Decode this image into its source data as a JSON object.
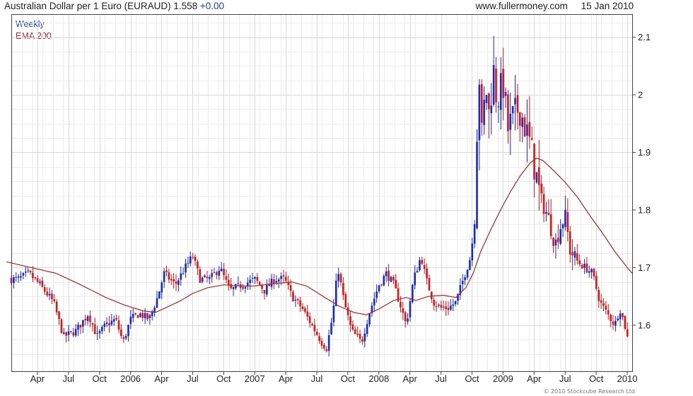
{
  "header": {
    "title": "Australian Dollar per 1 Euro (EURAUD)",
    "last": "1.558",
    "change": "+0.00",
    "site": "www.fullermoney.com",
    "date": "15 Jan 2010"
  },
  "footer": {
    "copyright": "© 2010 Stockcube Research Ltd"
  },
  "colors": {
    "up": "#1428d2",
    "down": "#dc1414",
    "ema": "#a02828",
    "grid": "#d8d8d8",
    "frame": "#444444"
  },
  "chart_data": {
    "type": "candlestick",
    "series": [
      {
        "name": "Weekly"
      },
      {
        "name": "EMA 200"
      }
    ],
    "x_axis_ticks": [
      "Apr",
      "Jul",
      "Oct",
      "2006",
      "Apr",
      "Jul",
      "Oct",
      "2007",
      "Apr",
      "Jul",
      "Oct",
      "2008",
      "Apr",
      "Jul",
      "Oct",
      "2009",
      "Apr",
      "Jul",
      "Oct",
      "2010"
    ],
    "x_tick_months": [
      2005.25,
      2005.5,
      2005.75,
      2006.0,
      2006.25,
      2006.5,
      2006.75,
      2007.0,
      2007.25,
      2007.5,
      2007.75,
      2008.0,
      2008.25,
      2008.5,
      2008.75,
      2009.0,
      2009.25,
      2009.5,
      2009.75,
      2010.0
    ],
    "xlim": [
      2005.04,
      2010.04
    ],
    "y_ticks": [
      1.6,
      1.7,
      1.8,
      1.9,
      2.0,
      2.1
    ],
    "ylim": [
      1.52,
      2.14
    ],
    "y_axis_position": "right",
    "grid": true,
    "legend_position": "top-left",
    "close_path": [
      [
        2005.04,
        1.68
      ],
      [
        2005.1,
        1.68
      ],
      [
        2005.18,
        1.69
      ],
      [
        2005.27,
        1.67
      ],
      [
        2005.38,
        1.64
      ],
      [
        2005.46,
        1.58
      ],
      [
        2005.56,
        1.59
      ],
      [
        2005.66,
        1.62
      ],
      [
        2005.73,
        1.58
      ],
      [
        2005.8,
        1.6
      ],
      [
        2005.88,
        1.61
      ],
      [
        2005.94,
        1.57
      ],
      [
        2006.0,
        1.61
      ],
      [
        2006.07,
        1.62
      ],
      [
        2006.15,
        1.61
      ],
      [
        2006.22,
        1.65
      ],
      [
        2006.27,
        1.69
      ],
      [
        2006.36,
        1.67
      ],
      [
        2006.44,
        1.7
      ],
      [
        2006.5,
        1.72
      ],
      [
        2006.56,
        1.68
      ],
      [
        2006.64,
        1.68
      ],
      [
        2006.72,
        1.7
      ],
      [
        2006.8,
        1.66
      ],
      [
        2006.9,
        1.67
      ],
      [
        2007.0,
        1.68
      ],
      [
        2007.08,
        1.66
      ],
      [
        2007.16,
        1.68
      ],
      [
        2007.24,
        1.68
      ],
      [
        2007.3,
        1.65
      ],
      [
        2007.38,
        1.63
      ],
      [
        2007.46,
        1.6
      ],
      [
        2007.54,
        1.57
      ],
      [
        2007.58,
        1.56
      ],
      [
        2007.63,
        1.62
      ],
      [
        2007.67,
        1.7
      ],
      [
        2007.72,
        1.64
      ],
      [
        2007.78,
        1.59
      ],
      [
        2007.86,
        1.57
      ],
      [
        2007.92,
        1.62
      ],
      [
        2008.0,
        1.67
      ],
      [
        2008.06,
        1.69
      ],
      [
        2008.12,
        1.67
      ],
      [
        2008.18,
        1.63
      ],
      [
        2008.22,
        1.6
      ],
      [
        2008.28,
        1.68
      ],
      [
        2008.34,
        1.72
      ],
      [
        2008.38,
        1.68
      ],
      [
        2008.44,
        1.64
      ],
      [
        2008.5,
        1.63
      ],
      [
        2008.56,
        1.63
      ],
      [
        2008.62,
        1.64
      ],
      [
        2008.68,
        1.68
      ],
      [
        2008.74,
        1.72
      ],
      [
        2008.78,
        1.8
      ],
      [
        2008.8,
        2.08
      ],
      [
        2008.83,
        1.92
      ],
      [
        2008.86,
        2.02
      ],
      [
        2008.89,
        1.96
      ],
      [
        2008.92,
        2.05
      ],
      [
        2008.95,
        1.99
      ],
      [
        2009.0,
        2.02
      ],
      [
        2009.04,
        1.94
      ],
      [
        2009.08,
        1.96
      ],
      [
        2009.13,
        1.98
      ],
      [
        2009.17,
        1.95
      ],
      [
        2009.21,
        1.92
      ],
      [
        2009.25,
        1.88
      ],
      [
        2009.3,
        1.82
      ],
      [
        2009.36,
        1.79
      ],
      [
        2009.42,
        1.74
      ],
      [
        2009.46,
        1.77
      ],
      [
        2009.5,
        1.79
      ],
      [
        2009.54,
        1.73
      ],
      [
        2009.6,
        1.71
      ],
      [
        2009.66,
        1.7
      ],
      [
        2009.72,
        1.69
      ],
      [
        2009.78,
        1.64
      ],
      [
        2009.84,
        1.62
      ],
      [
        2009.9,
        1.6
      ],
      [
        2009.94,
        1.63
      ],
      [
        2009.98,
        1.6
      ],
      [
        2010.02,
        1.56
      ]
    ],
    "ema_path": [
      [
        2005.0,
        1.71
      ],
      [
        2005.2,
        1.7
      ],
      [
        2005.4,
        1.69
      ],
      [
        2005.6,
        1.67
      ],
      [
        2005.8,
        1.648
      ],
      [
        2005.95,
        1.635
      ],
      [
        2006.1,
        1.625
      ],
      [
        2006.2,
        1.622
      ],
      [
        2006.3,
        1.632
      ],
      [
        2006.4,
        1.642
      ],
      [
        2006.5,
        1.655
      ],
      [
        2006.62,
        1.665
      ],
      [
        2006.75,
        1.67
      ],
      [
        2006.9,
        1.668
      ],
      [
        2007.0,
        1.668
      ],
      [
        2007.15,
        1.672
      ],
      [
        2007.3,
        1.675
      ],
      [
        2007.42,
        1.668
      ],
      [
        2007.55,
        1.65
      ],
      [
        2007.68,
        1.633
      ],
      [
        2007.8,
        1.622
      ],
      [
        2007.9,
        1.618
      ],
      [
        2008.0,
        1.628
      ],
      [
        2008.12,
        1.643
      ],
      [
        2008.22,
        1.648
      ],
      [
        2008.3,
        1.643
      ],
      [
        2008.4,
        1.65
      ],
      [
        2008.52,
        1.652
      ],
      [
        2008.62,
        1.648
      ],
      [
        2008.7,
        1.665
      ],
      [
        2008.76,
        1.69
      ],
      [
        2008.82,
        1.728
      ],
      [
        2008.9,
        1.765
      ],
      [
        2008.98,
        1.8
      ],
      [
        2009.06,
        1.832
      ],
      [
        2009.14,
        1.86
      ],
      [
        2009.22,
        1.882
      ],
      [
        2009.27,
        1.89
      ],
      [
        2009.32,
        1.886
      ],
      [
        2009.4,
        1.87
      ],
      [
        2009.5,
        1.848
      ],
      [
        2009.6,
        1.822
      ],
      [
        2009.7,
        1.79
      ],
      [
        2009.8,
        1.76
      ],
      [
        2009.9,
        1.728
      ],
      [
        2010.0,
        1.7
      ],
      [
        2010.04,
        1.69
      ]
    ]
  }
}
